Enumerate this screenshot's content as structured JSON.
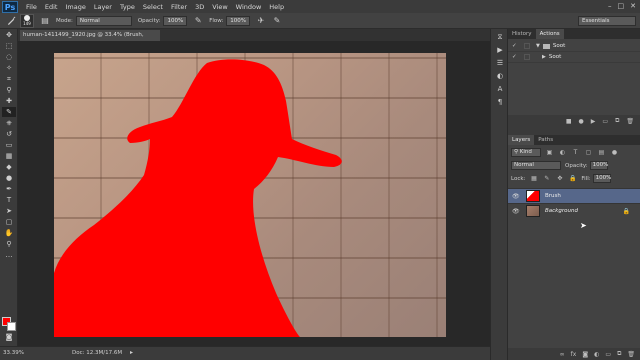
{
  "app": {
    "logo": "Ps"
  },
  "menu": [
    "File",
    "Edit",
    "Image",
    "Layer",
    "Type",
    "Select",
    "Filter",
    "3D",
    "View",
    "Window",
    "Help"
  ],
  "window_controls": [
    "–",
    "□",
    "✕"
  ],
  "options": {
    "brush_size": "149",
    "mode_label": "Mode:",
    "mode_value": "Normal",
    "opacity_label": "Opacity:",
    "opacity_value": "100%",
    "flow_label": "Flow:",
    "flow_value": "100%",
    "workspace": "Essentials"
  },
  "document": {
    "tab_title": "human-1411499_1920.jpg @ 33.4% (Brush, RGB/8) *",
    "fill_color": "#ff0000"
  },
  "status": {
    "zoom": "33.39%",
    "doc_info": "Doc: 12.3M/17.6M"
  },
  "panels": {
    "top_tabs": [
      "History",
      "Actions"
    ],
    "actions": [
      {
        "label": "Soot",
        "type": "set"
      },
      {
        "label": "Soot",
        "type": "action"
      }
    ],
    "layer_tabs": [
      "Layers",
      "Paths"
    ],
    "kind_label": "Kind",
    "blend_mode": "Normal",
    "opacity_label": "Opacity:",
    "opacity_value": "100%",
    "lock_label": "Lock:",
    "fill_label": "Fill:",
    "fill_value": "100%",
    "layers": [
      {
        "name": "Brush",
        "selected": true
      },
      {
        "name": "Background",
        "selected": false
      }
    ]
  }
}
